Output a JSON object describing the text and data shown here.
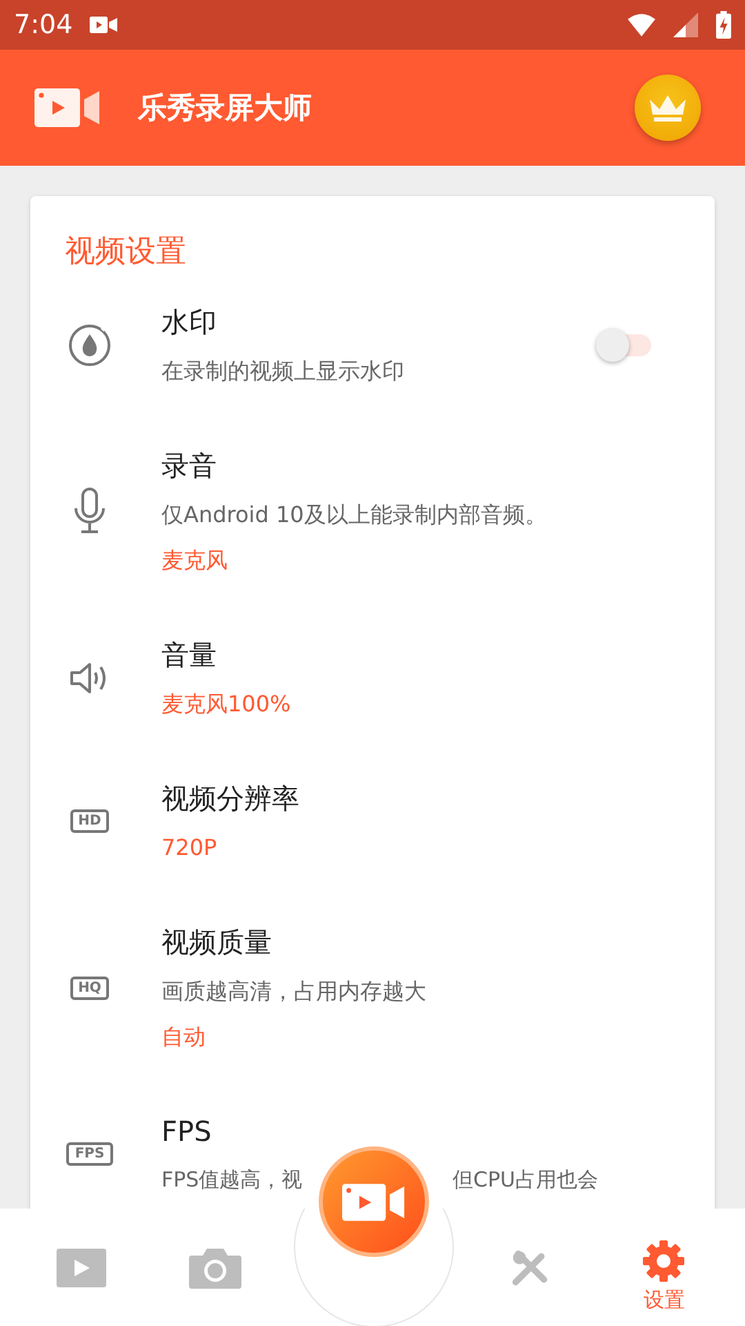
{
  "status_bar": {
    "time": "7:04"
  },
  "app_bar": {
    "title": "乐秀录屏大师"
  },
  "section": {
    "title": "视频设置"
  },
  "settings": [
    {
      "kind": "watermark",
      "title": "水印",
      "description": "在录制的视频上显示水印",
      "toggle": {
        "on": false
      }
    },
    {
      "kind": "mic",
      "title": "录音",
      "description": "仅Android 10及以上能录制内部音频。",
      "value": "麦克风"
    },
    {
      "kind": "volume",
      "title": "音量",
      "value": "麦克风100%"
    },
    {
      "kind": "badge",
      "icon_text": "HD",
      "title": "视频分辨率",
      "value": "720P"
    },
    {
      "kind": "badge",
      "icon_text": "HQ",
      "title": "视频质量",
      "description": "画质越高清，占用内存越大",
      "value": "自动"
    },
    {
      "kind": "badge",
      "icon_text": "FPS",
      "title": "FPS",
      "description_parts": [
        "FPS值越高，视",
        "但CPU占用也会"
      ]
    }
  ],
  "bottom_nav": [
    {
      "kind": "video",
      "selected": false
    },
    {
      "kind": "photo",
      "selected": false
    },
    {
      "kind": "tools",
      "selected": false
    },
    {
      "kind": "settings",
      "selected": true,
      "label": "设置"
    }
  ]
}
